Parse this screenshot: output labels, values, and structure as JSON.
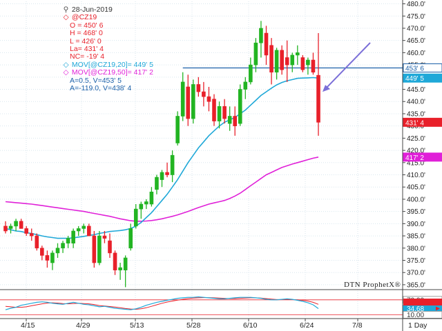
{
  "legend": {
    "date": "28-Jun-2019",
    "symbol": "@CZ19",
    "open": "O = 450' 6",
    "high": "H = 468' 0",
    "low": "L = 426' 0",
    "last": "La= 431' 4",
    "net_change": "NC= -19' 4",
    "ma20": "MOV[@CZ19,20]= 449' 5",
    "ma50": "MOV[@CZ19,50]= 417' 2",
    "cursor1": "A=0.5, V=453' 5",
    "cursor2": "A=-119.0, V=438' 4"
  },
  "watermark": "DTN ProphetX®",
  "interval_label": "1 Day",
  "price_tags": [
    {
      "label": "453' 6",
      "value": 453.75,
      "bg": "#ffffff",
      "fg": "#1a5fa8",
      "border": "#1a5fa8"
    },
    {
      "label": "449' 5",
      "value": 449.6,
      "bg": "#1fa8d8",
      "fg": "#ffffff",
      "border": "#1fa8d8"
    },
    {
      "label": "431' 4",
      "value": 431.5,
      "bg": "#e8202a",
      "fg": "#ffffff",
      "border": "#e8202a"
    },
    {
      "label": "417' 2",
      "value": 417.25,
      "bg": "#e020d8",
      "fg": "#ffffff",
      "border": "#e020d8"
    }
  ],
  "oscillator_tags": [
    {
      "label": "70.00",
      "bg": "#ffffff",
      "fg": "#333333"
    },
    {
      "label": "34.68",
      "bg": "#1fa8d8",
      "fg": "#ffffff"
    },
    {
      "label": "10.00",
      "bg": "#ffffff",
      "fg": "#333333"
    }
  ],
  "colors": {
    "up": "#22b422",
    "down": "#e8202a",
    "ma20": "#1fa8d8",
    "ma50": "#e020d8",
    "resistance": "#1a5fa8",
    "arrow": "#7b6fd8",
    "grid": "#d8e6ee"
  },
  "chart_data": {
    "type": "candlestick",
    "symbol": "@CZ19",
    "x_tick_labels": [
      "4/15",
      "4/29",
      "5/13",
      "5/28",
      "6/10",
      "6/24",
      "7/8"
    ],
    "y_tick_labels": [
      "365.0'",
      "370.0'",
      "375.0'",
      "380.0'",
      "385.0'",
      "390.0'",
      "395.0'",
      "400.0'",
      "405.0'",
      "410.0'",
      "415.0'",
      "420.0'",
      "425.0'",
      "430.0'",
      "435.0'",
      "440.0'",
      "445.0'",
      "450.0'",
      "455.0'",
      "460.0'",
      "465.0'",
      "470.0'",
      "475.0'",
      "480.0'"
    ],
    "ylim": [
      363,
      481
    ],
    "grid": true,
    "candles": [
      {
        "o": 389,
        "h": 391,
        "l": 386,
        "c": 387
      },
      {
        "o": 388,
        "h": 390,
        "l": 386,
        "c": 389
      },
      {
        "o": 389,
        "h": 392,
        "l": 387,
        "c": 391
      },
      {
        "o": 391,
        "h": 392,
        "l": 388,
        "c": 388
      },
      {
        "o": 388,
        "h": 389,
        "l": 385,
        "c": 386
      },
      {
        "o": 386,
        "h": 388,
        "l": 383,
        "c": 385
      },
      {
        "o": 385,
        "h": 386,
        "l": 379,
        "c": 380
      },
      {
        "o": 380,
        "h": 381,
        "l": 375,
        "c": 377
      },
      {
        "o": 377,
        "h": 379,
        "l": 372,
        "c": 375
      },
      {
        "o": 374,
        "h": 379,
        "l": 371,
        "c": 378
      },
      {
        "o": 378,
        "h": 382,
        "l": 376,
        "c": 380
      },
      {
        "o": 380,
        "h": 383,
        "l": 378,
        "c": 382
      },
      {
        "o": 382,
        "h": 385,
        "l": 380,
        "c": 384
      },
      {
        "o": 382,
        "h": 388,
        "l": 380,
        "c": 387
      },
      {
        "o": 387,
        "h": 389,
        "l": 385,
        "c": 388
      },
      {
        "o": 388,
        "h": 390,
        "l": 386,
        "c": 389
      },
      {
        "o": 389,
        "h": 390,
        "l": 385,
        "c": 385
      },
      {
        "o": 385,
        "h": 387,
        "l": 372,
        "c": 374
      },
      {
        "o": 374,
        "h": 387,
        "l": 373,
        "c": 385
      },
      {
        "o": 385,
        "h": 387,
        "l": 382,
        "c": 384
      },
      {
        "o": 383,
        "h": 386,
        "l": 376,
        "c": 378
      },
      {
        "o": 378,
        "h": 379,
        "l": 369,
        "c": 371
      },
      {
        "o": 371,
        "h": 374,
        "l": 367,
        "c": 372
      },
      {
        "o": 371,
        "h": 377,
        "l": 364,
        "c": 376
      },
      {
        "o": 380,
        "h": 390,
        "l": 379,
        "c": 388
      },
      {
        "o": 389,
        "h": 398,
        "l": 388,
        "c": 396
      },
      {
        "o": 396,
        "h": 399,
        "l": 392,
        "c": 398
      },
      {
        "o": 398,
        "h": 400,
        "l": 396,
        "c": 399
      },
      {
        "o": 398,
        "h": 405,
        "l": 397,
        "c": 403
      },
      {
        "o": 404,
        "h": 410,
        "l": 402,
        "c": 409
      },
      {
        "o": 408,
        "h": 412,
        "l": 405,
        "c": 411
      },
      {
        "o": 411,
        "h": 415,
        "l": 409,
        "c": 410
      },
      {
        "o": 410,
        "h": 420,
        "l": 407,
        "c": 418
      },
      {
        "o": 423,
        "h": 436,
        "l": 422,
        "c": 434
      },
      {
        "o": 434,
        "h": 452,
        "l": 432,
        "c": 448
      },
      {
        "o": 446,
        "h": 451,
        "l": 430,
        "c": 433
      },
      {
        "o": 433,
        "h": 449,
        "l": 431,
        "c": 447
      },
      {
        "o": 447,
        "h": 450,
        "l": 442,
        "c": 444
      },
      {
        "o": 444,
        "h": 448,
        "l": 438,
        "c": 442
      },
      {
        "o": 442,
        "h": 446,
        "l": 436,
        "c": 440
      },
      {
        "o": 441,
        "h": 443,
        "l": 430,
        "c": 432
      },
      {
        "o": 432,
        "h": 440,
        "l": 429,
        "c": 438
      },
      {
        "o": 438,
        "h": 441,
        "l": 431,
        "c": 433
      },
      {
        "o": 431,
        "h": 438,
        "l": 428,
        "c": 434
      },
      {
        "o": 434,
        "h": 438,
        "l": 426,
        "c": 430
      },
      {
        "o": 431,
        "h": 447,
        "l": 430,
        "c": 445
      },
      {
        "o": 445,
        "h": 450,
        "l": 441,
        "c": 448
      },
      {
        "o": 448,
        "h": 458,
        "l": 447,
        "c": 455
      },
      {
        "o": 455,
        "h": 466,
        "l": 452,
        "c": 464
      },
      {
        "o": 464,
        "h": 473,
        "l": 458,
        "c": 470
      },
      {
        "o": 468,
        "h": 471,
        "l": 455,
        "c": 459
      },
      {
        "o": 463,
        "h": 466,
        "l": 447,
        "c": 452
      },
      {
        "o": 452,
        "h": 462,
        "l": 449,
        "c": 461
      },
      {
        "o": 461,
        "h": 463,
        "l": 451,
        "c": 453
      },
      {
        "o": 458,
        "h": 465,
        "l": 448,
        "c": 455
      },
      {
        "o": 455,
        "h": 460,
        "l": 452,
        "c": 459
      },
      {
        "o": 459,
        "h": 463,
        "l": 455,
        "c": 460
      },
      {
        "o": 458,
        "h": 459,
        "l": 452,
        "c": 453
      },
      {
        "o": 455,
        "h": 458,
        "l": 451,
        "c": 457
      },
      {
        "o": 457,
        "h": 460,
        "l": 451,
        "c": 452
      },
      {
        "o": 450.75,
        "h": 468,
        "l": 426,
        "c": 431.5
      }
    ],
    "ma20": [
      388,
      387.5,
      387,
      386.8,
      386.3,
      386,
      385.5,
      385,
      384.6,
      384.3,
      384,
      384,
      384,
      384.2,
      384.5,
      384.8,
      385.2,
      385.5,
      386,
      386.4,
      386.8,
      387,
      387.2,
      387.5,
      388,
      389,
      390.5,
      392.5,
      394.5,
      397,
      399.5,
      402,
      405,
      408,
      411.5,
      415,
      418,
      421,
      423.5,
      426,
      428,
      430,
      431.5,
      432.5,
      433.5,
      435,
      436.5,
      438.5,
      440.5,
      442.5,
      444,
      445.5,
      446.8,
      447.8,
      448.5,
      449,
      449.5,
      449.6,
      449.7,
      449.8,
      449.6
    ],
    "ma50": [
      399,
      398.8,
      398.6,
      398.4,
      398.2,
      398,
      397.7,
      397.4,
      397.1,
      396.8,
      396.5,
      396.2,
      395.9,
      395.6,
      395.3,
      395,
      394.6,
      394.2,
      393.8,
      393.4,
      393,
      392.5,
      392,
      391.6,
      391.2,
      391,
      391,
      391.1,
      391.3,
      391.6,
      392,
      392.5,
      393,
      393.6,
      394.3,
      395,
      395.8,
      396.6,
      397.3,
      398,
      398.5,
      399,
      399.5,
      400.3,
      401.3,
      402.5,
      404,
      405.5,
      407,
      408.5,
      410,
      411,
      412,
      413,
      413.7,
      414.4,
      415,
      415.6,
      416.2,
      416.8,
      417.25
    ],
    "resistance_level": 453.75,
    "oscillator": {
      "levels": [
        70,
        10
      ],
      "ylim": [
        0,
        100
      ],
      "tick_labels": [
        "70.00",
        "34.68",
        "10.00"
      ],
      "k": [
        30,
        36,
        40,
        48,
        52,
        56,
        60,
        62,
        60,
        56,
        54,
        52,
        56,
        60,
        56,
        52,
        50,
        46,
        42,
        44,
        40,
        36,
        34,
        32,
        30,
        34,
        40,
        48,
        54,
        60,
        64,
        68,
        72,
        76,
        78,
        80,
        80,
        82,
        80,
        78,
        76,
        74,
        74,
        76,
        78,
        80,
        80,
        80,
        78,
        76,
        72,
        70,
        70,
        72,
        74,
        72,
        68,
        64,
        58,
        50,
        34.68
      ],
      "d": [
        44,
        42,
        40,
        40,
        42,
        46,
        50,
        54,
        57,
        58,
        57,
        55,
        54,
        55,
        56,
        55,
        54,
        51,
        47,
        45,
        43,
        41,
        38,
        35,
        33,
        32,
        34,
        38,
        44,
        50,
        56,
        61,
        65,
        69,
        72,
        75,
        77,
        78,
        79,
        79,
        78,
        77,
        76,
        75,
        75,
        76,
        77,
        78,
        78,
        77,
        75,
        73,
        71,
        71,
        71,
        71,
        70,
        68,
        65,
        60,
        52
      ]
    }
  }
}
